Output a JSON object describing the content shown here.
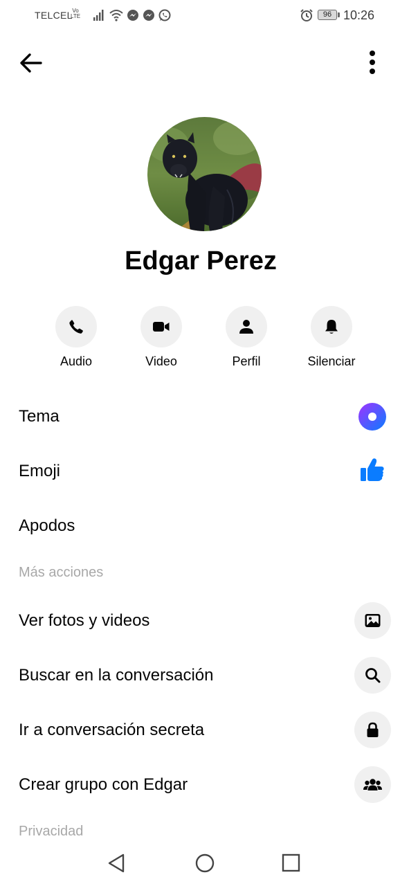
{
  "status_bar": {
    "carrier": "TELCEL",
    "volte_top": "Vo",
    "volte_bottom": "LTE",
    "battery": "96",
    "time": "10:26",
    "icons": [
      "signal-icon",
      "wifi-icon",
      "messenger-icon",
      "messenger-icon",
      "whatsapp-icon",
      "alarm-icon"
    ]
  },
  "header": {
    "back_icon": "arrow-left-icon",
    "more_icon": "more-vertical-icon"
  },
  "profile": {
    "name": "Edgar Perez"
  },
  "actions": [
    {
      "label": "Audio",
      "icon": "phone-icon"
    },
    {
      "label": "Video",
      "icon": "video-camera-icon"
    },
    {
      "label": "Perfil",
      "icon": "person-icon"
    },
    {
      "label": "Silenciar",
      "icon": "bell-icon"
    }
  ],
  "customize": [
    {
      "label": "Tema",
      "icon": "theme-gradient-icon"
    },
    {
      "label": "Emoji",
      "icon": "thumbs-up-icon"
    },
    {
      "label": "Apodos"
    }
  ],
  "more_actions": {
    "header": "Más acciones",
    "items": [
      {
        "label": "Ver fotos y videos",
        "icon": "photo-icon"
      },
      {
        "label": "Buscar en la conversación",
        "icon": "search-icon"
      },
      {
        "label": "Ir a conversación secreta",
        "icon": "lock-icon"
      },
      {
        "label": "Crear grupo con Edgar",
        "icon": "group-icon"
      }
    ]
  },
  "privacy": {
    "header": "Privacidad"
  },
  "colors": {
    "accent_blue": "#0a7cff",
    "icon_bg": "#f0f0f0",
    "section_header": "#a8a8a8",
    "theme_gradient_start": "#a033ff",
    "theme_gradient_end": "#0a7cff"
  },
  "nav": [
    "back-triangle-icon",
    "home-circle-icon",
    "recents-square-icon"
  ]
}
